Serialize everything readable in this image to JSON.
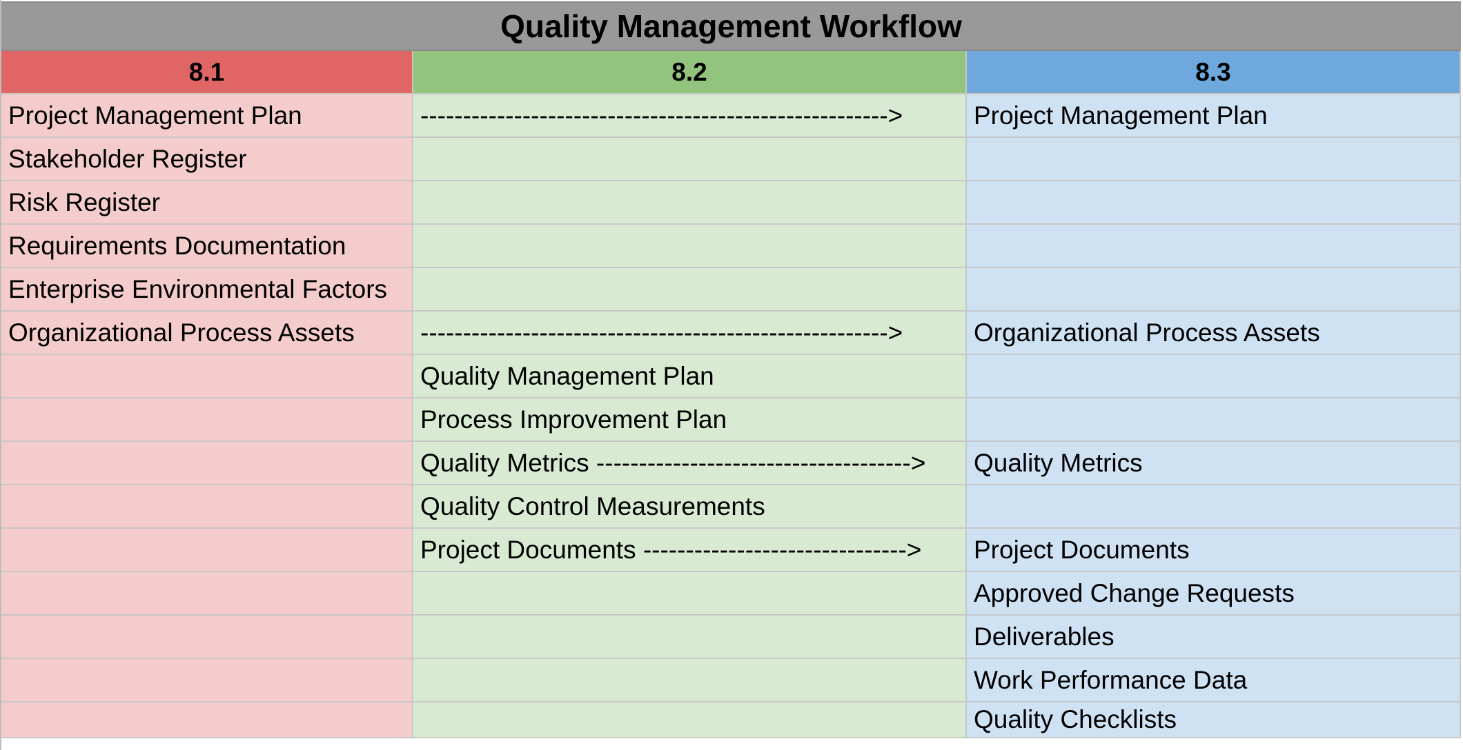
{
  "title": "Quality Management Workflow",
  "headers": [
    "8.1",
    "8.2",
    "8.3"
  ],
  "colors": {
    "title_bg": "#999999",
    "col1_header": "#e06666",
    "col2_header": "#93c47d",
    "col3_header": "#6fa8dc",
    "col1_bg": "#f4cccc",
    "col2_bg": "#d9ead3",
    "col3_bg": "#cfe2f3"
  },
  "rows": [
    [
      "Project Management Plan",
      "------------------------------------------------------->",
      "Project Management Plan"
    ],
    [
      "Stakeholder Register",
      "",
      ""
    ],
    [
      "Risk Register",
      "",
      ""
    ],
    [
      "Requirements Documentation",
      "",
      ""
    ],
    [
      "Enterprise Environmental Factors",
      "",
      ""
    ],
    [
      "Organizational Process Assets",
      "------------------------------------------------------->",
      "Organizational Process Assets"
    ],
    [
      "",
      "Quality Management Plan",
      ""
    ],
    [
      "",
      "Process Improvement Plan",
      ""
    ],
    [
      "",
      "Quality Metrics ------------------------------------->",
      "Quality Metrics"
    ],
    [
      "",
      "Quality Control Measurements",
      ""
    ],
    [
      "",
      "Project Documents ------------------------------->",
      "Project Documents"
    ],
    [
      "",
      "",
      "Approved Change Requests"
    ],
    [
      "",
      "",
      "Deliverables"
    ],
    [
      "",
      "",
      "Work Performance Data"
    ],
    [
      "",
      "",
      "Quality Checklists"
    ]
  ]
}
